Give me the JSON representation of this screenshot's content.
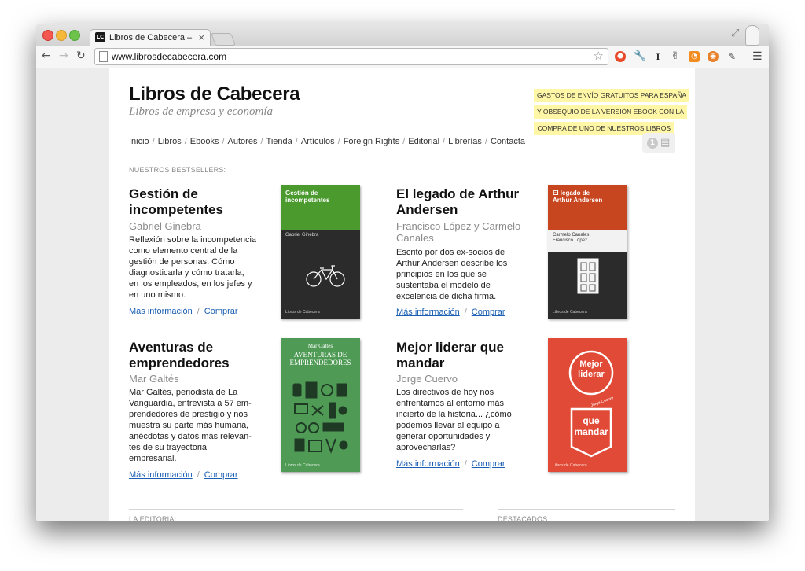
{
  "browser": {
    "tab_title": "Libros de Cabecera – Edito",
    "tab_close": "×",
    "favicon_text": "LC",
    "url": "www.librosdecabecera.com",
    "icons": [
      "back-icon",
      "forward-icon",
      "reload-icon",
      "star-icon",
      "extension-icons",
      "menu-icon"
    ]
  },
  "header": {
    "title": "Libros de Cabecera",
    "subtitle": "Libros de empresa y economía",
    "promo_lines": [
      "GASTOS DE ENVÍO GRATUITOS PARA ESPAÑA",
      "Y OBSEQUIO DE LA VERSIÓN EBOOK CON LA",
      "COMPRA DE UNO DE NUESTROS LIBROS"
    ]
  },
  "nav": {
    "items": [
      "Inicio",
      "Libros",
      "Ebooks",
      "Autores",
      "Tienda",
      "Artículos",
      "Foreign Rights",
      "Editorial",
      "Librerías",
      "Contacta"
    ],
    "separator": "/",
    "cart_count": "1"
  },
  "bestsellers": {
    "label": "NUESTROS BESTSELLERS:",
    "more_label": "Más información",
    "buy_label": "Comprar",
    "link_separator": "/",
    "books": [
      {
        "title_lines": [
          "Gestión de",
          "incompetentes"
        ],
        "author": "Gabriel Ginebra",
        "desc_lines": [
          "Reflexión sobre la incompetencia",
          "como elemento central de la",
          "gestión de personas. Cómo",
          "diagnosticarla y cómo tratarla,",
          "en los empleados, en los jefes y",
          "en uno mismo."
        ],
        "cover": {
          "title_lines": [
            "Gestión de",
            "incompetentes"
          ],
          "author": "Gabriel Ginebra",
          "publisher": "Libros de Cabecera",
          "top_color": "#4a9a2e",
          "bottom_color": "#2b2b2b"
        }
      },
      {
        "title_lines": [
          "El legado de Arthur",
          "Andersen"
        ],
        "author_lines": [
          "Francisco López y Carmelo",
          "Canales"
        ],
        "desc_lines": [
          "Escrito por dos ex-socios de",
          "Arthur Andersen describe los",
          "principios en los que se",
          "sustentaba el modelo de",
          "excelencia de dicha firma."
        ],
        "cover": {
          "title_lines": [
            "El legado de",
            "Arthur Andersen"
          ],
          "author_lines": [
            "Carmelo Canales",
            "Francisco López"
          ],
          "publisher": "Libros de Cabecera",
          "top_color": "#c8461f",
          "bottom_color": "#2b2b2b"
        }
      },
      {
        "title_lines": [
          "Aventuras de",
          "emprendedores"
        ],
        "author": "Mar Galtés",
        "desc_lines": [
          "Mar Galtés, periodista de La",
          "Vanguardia, entrevista a 57 em-",
          "prendedores de prestigio y nos",
          "muestra su parte más humana,",
          "anécdotas y datos más relevan-",
          "tes de su trayectoria",
          "empresarial."
        ],
        "cover": {
          "author": "Mar Galtés",
          "title_lines": [
            "AVENTURAS DE",
            "EMPRENDEDORES"
          ],
          "publisher": "Libros de Cabecera",
          "color": "#4f9a55"
        }
      },
      {
        "title_lines": [
          "Mejor liderar que",
          "mandar"
        ],
        "author": "Jorge Cuervo",
        "desc_lines": [
          "Los directivos de hoy nos",
          "enfrentamos al entorno más",
          "incierto de la historia... ¿cómo",
          "podemos llevar al equipo a",
          "generar oportunidades y",
          "aprovecharlas?"
        ],
        "cover": {
          "title_top_lines": [
            "Mejor",
            "liderar"
          ],
          "title_bottom_lines": [
            "que",
            "mandar"
          ],
          "author": "Jorge Cuervo",
          "publisher": "Libros de Cabecera",
          "color": "#e04a36"
        }
      }
    ]
  },
  "footer_sections": {
    "left_label": "LA EDITORIAL:",
    "right_label": "DESTACADOS:"
  }
}
